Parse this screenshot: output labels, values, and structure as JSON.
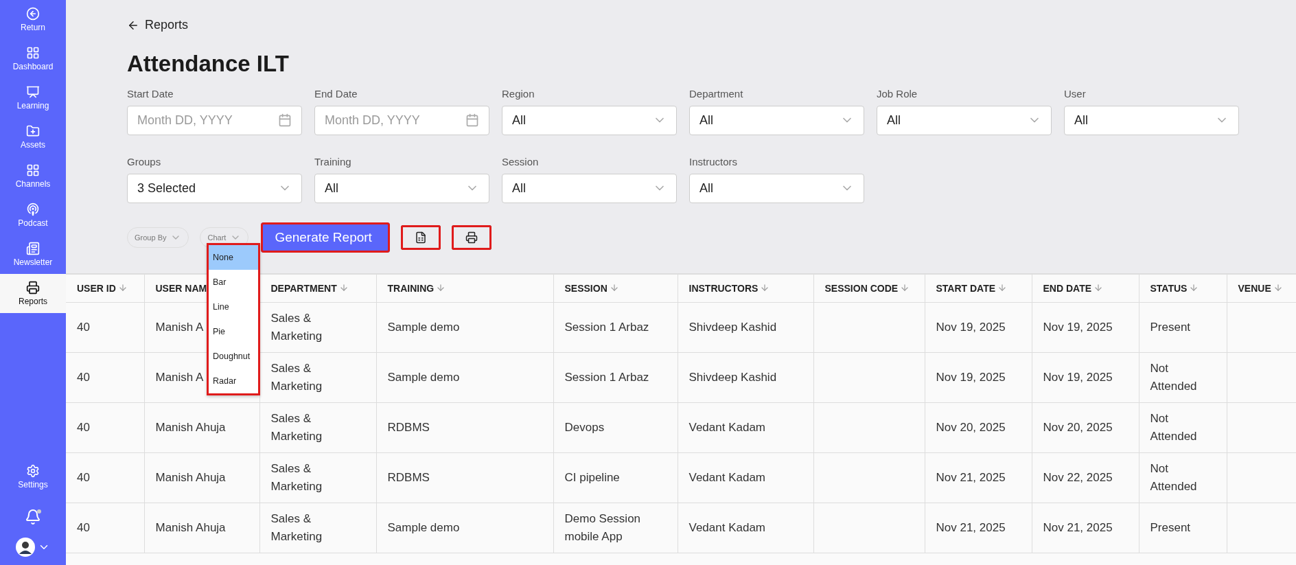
{
  "sidebar": {
    "items": [
      {
        "label": "Return",
        "selected": false
      },
      {
        "label": "Dashboard",
        "selected": false
      },
      {
        "label": "Learning",
        "selected": false
      },
      {
        "label": "Assets",
        "selected": false
      },
      {
        "label": "Channels",
        "selected": false
      },
      {
        "label": "Podcast",
        "selected": false
      },
      {
        "label": "Newsletter",
        "selected": false
      },
      {
        "label": "Reports",
        "selected": true
      }
    ],
    "bottom": {
      "settings": "Settings",
      "notification_dot": true
    }
  },
  "back_link": "Reports",
  "title": "Attendance ILT",
  "filters": [
    {
      "label": "Start Date",
      "kind": "date",
      "placeholder": "Month DD, YYYY"
    },
    {
      "label": "End Date",
      "kind": "date",
      "placeholder": "Month DD, YYYY"
    },
    {
      "label": "Region",
      "kind": "select",
      "value": "All"
    },
    {
      "label": "Department",
      "kind": "select",
      "value": "All"
    },
    {
      "label": "Job Role",
      "kind": "select",
      "value": "All"
    },
    {
      "label": "User",
      "kind": "select",
      "value": "All"
    },
    {
      "label": "Groups",
      "kind": "select",
      "value": "3 Selected"
    },
    {
      "label": "Training",
      "kind": "select",
      "value": "All"
    },
    {
      "label": "Session",
      "kind": "select",
      "value": "All"
    },
    {
      "label": "Instructors",
      "kind": "select",
      "value": "All"
    }
  ],
  "toolbar": {
    "group_by": "Group By",
    "chart": "Chart",
    "generate": {
      "label": "Generate Report",
      "highlighted": true
    },
    "export_highlighted": true,
    "print_highlighted": true
  },
  "chart_menu": {
    "highlighted": true,
    "options": [
      {
        "label": "None",
        "selected": true
      },
      {
        "label": "Bar",
        "selected": false
      },
      {
        "label": "Line",
        "selected": false
      },
      {
        "label": "Pie",
        "selected": false
      },
      {
        "label": "Doughnut",
        "selected": false
      },
      {
        "label": "Radar",
        "selected": false
      }
    ]
  },
  "table": {
    "columns": [
      {
        "label": "USER ID",
        "sort_icon": true
      },
      {
        "label": "USER NAM"
      },
      {
        "label": "DEPARTMENT",
        "sort_icon": true
      },
      {
        "label": "TRAINING",
        "sort_icon": true
      },
      {
        "label": "SESSION",
        "sort_icon": true
      },
      {
        "label": "INSTRUCTORS",
        "sort_icon": true
      },
      {
        "label": "SESSION CODE",
        "sort_icon": true
      },
      {
        "label": "START DATE",
        "sort_icon": true
      },
      {
        "label": "END DATE",
        "sort_icon": true
      },
      {
        "label": "STATUS",
        "sort_icon": true
      },
      {
        "label": "VENUE",
        "sort_icon": true
      }
    ],
    "rows": [
      [
        "40",
        "Manish A",
        "Sales & Marketing",
        "Sample demo",
        "Session 1 Arbaz",
        "Shivdeep Kashid",
        null,
        "Nov 19, 2025",
        "Nov 19, 2025",
        "Present",
        null
      ],
      [
        "40",
        "Manish A",
        "Sales & Marketing",
        "Sample demo",
        "Session 1 Arbaz",
        "Shivdeep Kashid",
        null,
        "Nov 19, 2025",
        "Nov 19, 2025",
        "Not Attended",
        null
      ],
      [
        "40",
        "Manish Ahuja",
        "Sales & Marketing",
        "RDBMS",
        "Devops",
        "Vedant Kadam",
        null,
        "Nov 20, 2025",
        "Nov 20, 2025",
        "Not Attended",
        null
      ],
      [
        "40",
        "Manish Ahuja",
        "Sales & Marketing",
        "RDBMS",
        "CI pipeline",
        "Vedant Kadam",
        null,
        "Nov 21, 2025",
        "Nov 22, 2025",
        "Not Attended",
        null
      ],
      [
        "40",
        "Manish Ahuja",
        "Sales & Marketing",
        "Sample demo",
        "Demo Session mobile App",
        "Vedant Kadam",
        null,
        "Nov 21, 2025",
        "Nov 21, 2025",
        "Present",
        null
      ]
    ]
  }
}
